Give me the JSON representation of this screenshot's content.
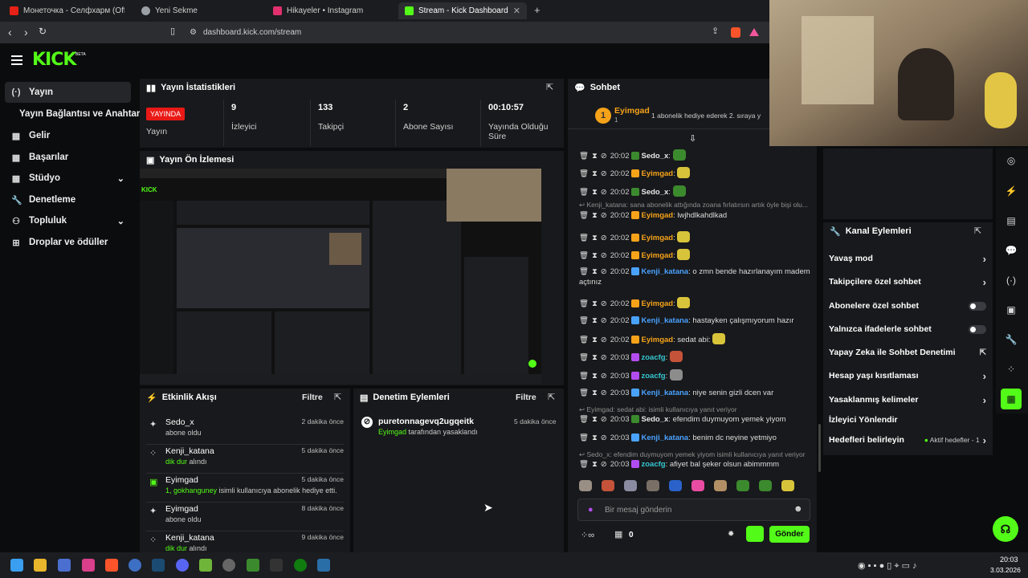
{
  "tabs": [
    {
      "title": "Монеточка - Селфхарм (Official Mu",
      "color": "#e62117"
    },
    {
      "title": "Yeni Sekme",
      "color": "#9aa0a6"
    },
    {
      "title": "Hikayeler • Instagram",
      "color": "#e1306c"
    },
    {
      "title": "Stream - Kick Dashboard",
      "color": "#53fc18"
    }
  ],
  "address": "dashboard.kick.com/stream",
  "logo": "KICK",
  "logo_badge": "BETA",
  "sidebar": {
    "items": [
      {
        "label": "Yayın",
        "icon": "(·)"
      },
      {
        "label": "Yayın Bağlantısı ve Anahtarı",
        "icon": ""
      },
      {
        "label": "Gelir",
        "icon": "▦"
      },
      {
        "label": "Başarılar",
        "icon": "▦"
      },
      {
        "label": "Stüdyo",
        "icon": "▦"
      },
      {
        "label": "Denetleme",
        "icon": "🔧"
      },
      {
        "label": "Topluluk",
        "icon": "⚇"
      },
      {
        "label": "Droplar ve ödüller",
        "icon": "⊞"
      }
    ]
  },
  "stats": {
    "title": "Yayın İstatistikleri",
    "live_badge": "YAYINDA",
    "live_label": "Yayın",
    "viewers": "9",
    "viewers_label": "İzleyici",
    "followers": "133",
    "followers_label": "Takipçi",
    "subs": "2",
    "subs_label": "Abone Sayısı",
    "uptime": "00:10:57",
    "uptime_label": "Yayında Olduğu Süre"
  },
  "preview": {
    "title": "Yayın Ön İzlemesi"
  },
  "activity": {
    "title": "Etkinlik Akışı",
    "filter": "Filtre",
    "items": [
      {
        "name": "Sedo_x",
        "sub": "abone oldu",
        "hl": "",
        "time": "2 dakika önce",
        "icon": "✦"
      },
      {
        "name": "Kenji_katana",
        "hl": "dik dur",
        "sub": " alındı",
        "time": "5 dakika önce",
        "icon": "⁘"
      },
      {
        "name": "Eyimgad",
        "hl": "1, gokhanguney",
        "sub": " isimli kullanıcıya abonelik hediye etti.",
        "time": "5 dakika önce",
        "icon": "▣"
      },
      {
        "name": "Eyimgad",
        "sub": "abone oldu",
        "hl": "",
        "time": "8 dakika önce",
        "icon": "✦"
      },
      {
        "name": "Kenji_katana",
        "hl": "dik dur",
        "sub": " alındı",
        "time": "9 dakika önce",
        "icon": "⁘"
      }
    ]
  },
  "moderation": {
    "title": "Denetim Eylemleri",
    "filter": "Filtre",
    "items": [
      {
        "name": "puretonnagevq2ugqeitk",
        "by": "Eyimgad",
        "rest": " tarafından yasaklandı",
        "time": "5 dakika önce"
      }
    ]
  },
  "chat": {
    "title": "Sohbet",
    "pinned_user": "Eyimgad",
    "pinned_sub": "1",
    "pinned_text": "1 abonelik hediye ederek 2. sıraya y",
    "messages": [
      {
        "time": "20:02",
        "user": "Sedo_x",
        "cls": "u-sedo",
        "text": "",
        "emote": "#3c8a2e"
      },
      {
        "time": "20:02",
        "user": "Eyimgad",
        "cls": "u-eyi",
        "text": "",
        "emote": "#d8c43a"
      },
      {
        "time": "20:02",
        "user": "Sedo_x",
        "cls": "u-sedo",
        "text": "",
        "emote": "#3c8a2e"
      },
      {
        "time": "20:02",
        "user": "Eyimgad",
        "cls": "u-eyi",
        "text": "lwjhdlkahdlkad",
        "emote": ""
      },
      {
        "time": "20:02",
        "user": "Eyimgad",
        "cls": "u-eyi",
        "text": "",
        "emote": "#d8c43a"
      },
      {
        "time": "20:02",
        "user": "Eyimgad",
        "cls": "u-eyi",
        "text": "",
        "emote": "#d8c43a"
      },
      {
        "time": "20:02",
        "user": "Kenji_katana",
        "cls": "u-kenji",
        "text": "o zmn bende hazırlanayım madem açtınız",
        "emote": ""
      },
      {
        "time": "20:02",
        "user": "Eyimgad",
        "cls": "u-eyi",
        "text": "",
        "emote": "#d8c43a"
      },
      {
        "time": "20:02",
        "user": "Kenji_katana",
        "cls": "u-kenji",
        "text": "hastayken çalışmıyorum hazır",
        "emote": ""
      },
      {
        "time": "20:02",
        "user": "Eyimgad",
        "cls": "u-eyi",
        "text": "sedat abi:",
        "emote": "#d8c43a"
      },
      {
        "time": "20:03",
        "user": "zoacfg",
        "cls": "u-zoa",
        "text": "",
        "emote": "#c5533a"
      },
      {
        "time": "20:03",
        "user": "zoacfg",
        "cls": "u-zoa",
        "text": "",
        "emote": "#8c8c8c"
      },
      {
        "time": "20:03",
        "user": "Kenji_katana",
        "cls": "u-kenji",
        "text": "niye senin gizli dcen var",
        "emote": ""
      },
      {
        "time": "20:03",
        "user": "Sedo_x",
        "cls": "u-sedo",
        "text": "efendim duymuyom yemek yiyom",
        "emote": ""
      },
      {
        "time": "20:03",
        "user": "Kenji_katana",
        "cls": "u-kenji",
        "text": "benim dc neyine yetmiyo",
        "emote": ""
      },
      {
        "time": "20:03",
        "user": "zoacfg",
        "cls": "u-zoa",
        "text": "afiyet bal şeker olsun abimmmm",
        "emote": ""
      }
    ],
    "replies": [
      "Kenji_katana: sana abonelik attığında zoana fırlatırsın artık öyle bişi olu...",
      "Eyimgad: sedat abi: isimli kullanıcıya yanıt veriyor",
      "Sedo_x: efendim duymuyom yemek yiyom isimli kullanıcıya yanıt veriyor"
    ],
    "input_placeholder": "Bir mesaj gönderin",
    "points": "0",
    "send": "Gönder"
  },
  "channel_actions": {
    "title": "Kanal Eylemleri",
    "rows": [
      {
        "label": "Yavaş mod",
        "kind": "arrow"
      },
      {
        "label": "Takipçilere özel sohbet",
        "kind": "arrow"
      },
      {
        "label": "Abonelere özel sohbet",
        "kind": "toggle"
      },
      {
        "label": "Yalnızca ifadelerle sohbet",
        "kind": "toggle"
      },
      {
        "label": "Yapay Zeka ile Sohbet Denetimi",
        "kind": "ext"
      },
      {
        "label": "Hesap yaşı kısıtlaması",
        "kind": "arrow"
      },
      {
        "label": "Yasaklanmış kelimeler",
        "kind": "arrow"
      },
      {
        "label": "İzleyici Yönlendir",
        "kind": "none"
      },
      {
        "label": "Hedefleri belirleyin",
        "kind": "goals"
      }
    ],
    "goals_status": "Aktif hedefler - 1"
  },
  "taskbar": {
    "time": "20:03",
    "date": "3.03.2026"
  }
}
